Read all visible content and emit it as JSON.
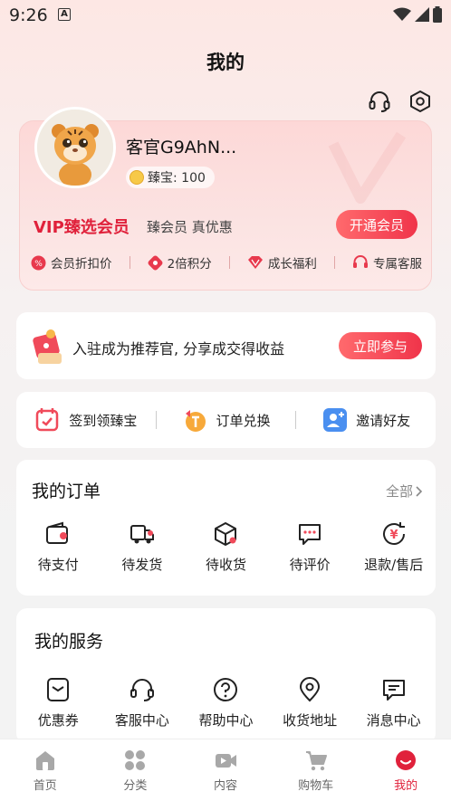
{
  "status": {
    "time": "9:26",
    "notif_glyph": "A"
  },
  "header": {
    "title": "我的",
    "icons": [
      "headset-icon",
      "settings-icon"
    ]
  },
  "profile": {
    "username": "客官G9AhN...",
    "treasure_label": "臻宝: 100"
  },
  "vip": {
    "title": "VIP臻选会员",
    "subtitle": "臻会员 真优惠",
    "button": "开通会员",
    "perks": [
      {
        "label": "会员折扣价",
        "icon": "discount-icon"
      },
      {
        "label": "2倍积分",
        "icon": "points-icon"
      },
      {
        "label": "成长福利",
        "icon": "diamond-icon"
      },
      {
        "label": "专属客服",
        "icon": "headset-icon"
      }
    ]
  },
  "referral": {
    "text": "入驻成为推荐官, 分享成交得收益",
    "button": "立即参与"
  },
  "quick_actions": [
    {
      "label": "签到领臻宝",
      "icon": "calendar-icon"
    },
    {
      "label": "订单兑换",
      "icon": "exchange-icon"
    },
    {
      "label": "邀请好友",
      "icon": "invite-icon"
    }
  ],
  "orders": {
    "title": "我的订单",
    "all_label": "全部",
    "items": [
      {
        "label": "待支付",
        "icon": "wallet-icon"
      },
      {
        "label": "待发货",
        "icon": "truck-icon"
      },
      {
        "label": "待收货",
        "icon": "package-icon"
      },
      {
        "label": "待评价",
        "icon": "comment-icon"
      },
      {
        "label": "退款/售后",
        "icon": "refund-icon"
      }
    ]
  },
  "services": {
    "title": "我的服务",
    "items": [
      {
        "label": "优惠券",
        "icon": "coupon-icon"
      },
      {
        "label": "客服中心",
        "icon": "headset-icon"
      },
      {
        "label": "帮助中心",
        "icon": "help-icon"
      },
      {
        "label": "收货地址",
        "icon": "location-icon"
      },
      {
        "label": "消息中心",
        "icon": "message-icon"
      }
    ]
  },
  "tabbar": {
    "active": "我的",
    "items": [
      {
        "label": "首页",
        "icon": "home-icon"
      },
      {
        "label": "分类",
        "icon": "category-icon"
      },
      {
        "label": "内容",
        "icon": "video-icon"
      },
      {
        "label": "购物车",
        "icon": "cart-icon"
      },
      {
        "label": "我的",
        "icon": "profile-icon"
      }
    ]
  },
  "colors": {
    "accent": "#e0213b",
    "button_gradient_start": "#ff6a6d",
    "button_gradient_end": "#f0344a"
  }
}
